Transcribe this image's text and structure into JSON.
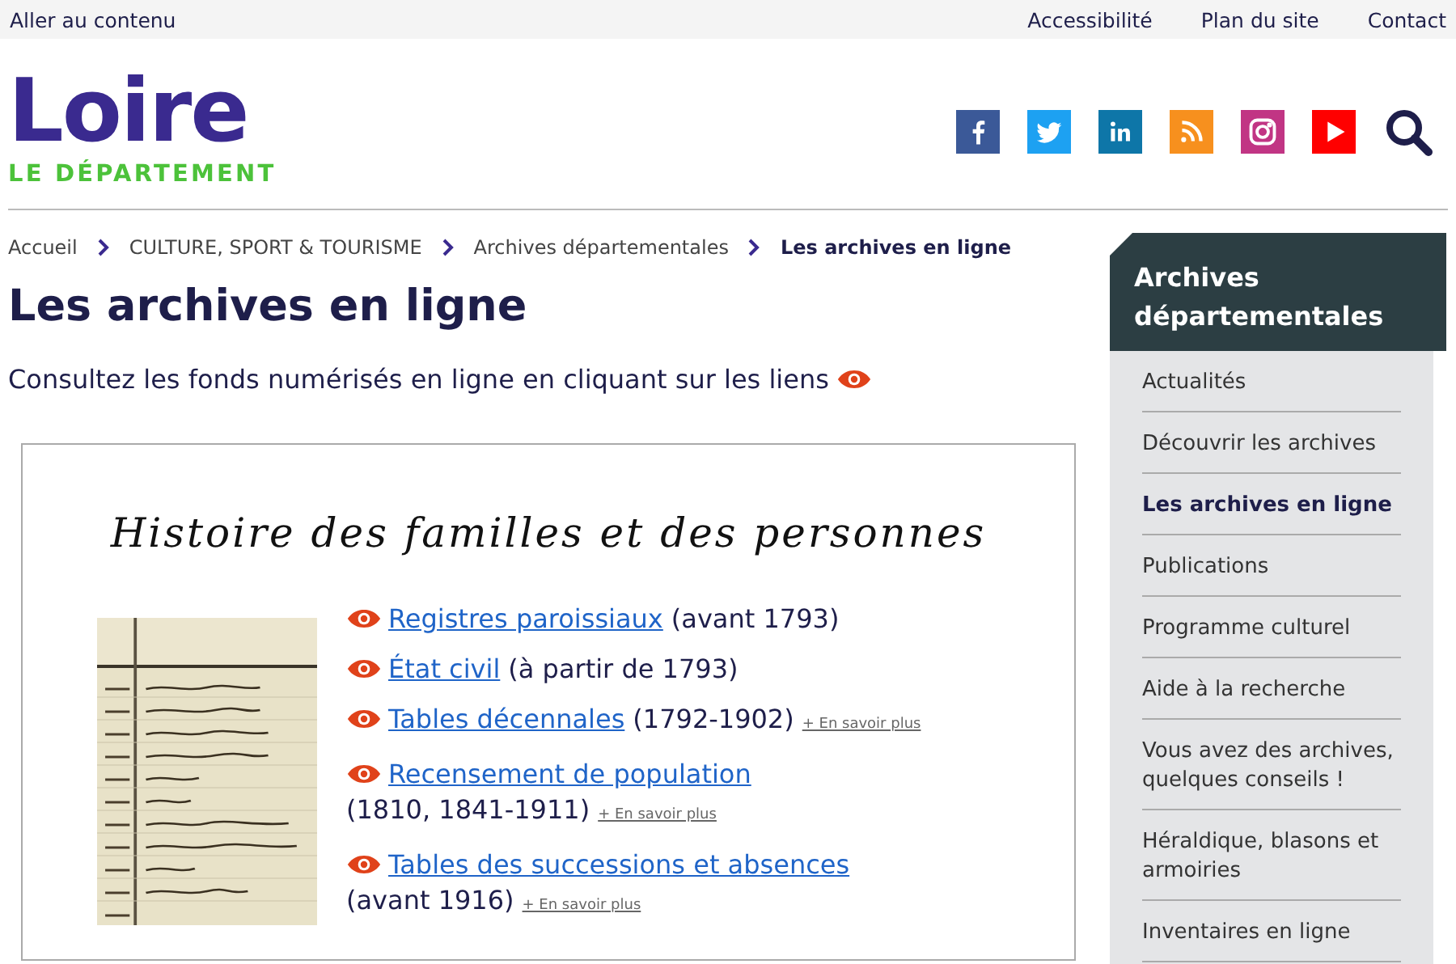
{
  "topbar": {
    "skip_link": "Aller au contenu",
    "links": [
      "Accessibilité",
      "Plan du site",
      "Contact"
    ]
  },
  "logo": {
    "name": "Loire",
    "subtitle": "LE DÉPARTEMENT"
  },
  "social": [
    {
      "kind": "facebook"
    },
    {
      "kind": "twitter"
    },
    {
      "kind": "linkedin"
    },
    {
      "kind": "rss"
    },
    {
      "kind": "instagram"
    },
    {
      "kind": "youtube"
    }
  ],
  "breadcrumb": [
    {
      "label": "Accueil",
      "current": false
    },
    {
      "label": "CULTURE, SPORT & TOURISME",
      "current": false
    },
    {
      "label": "Archives départementales",
      "current": false
    },
    {
      "label": "Les archives en ligne",
      "current": true
    }
  ],
  "title": "Les archives en ligne",
  "intro": "Consultez les fonds numérisés en ligne en cliquant sur les liens",
  "panel": {
    "heading": "Histoire des familles et des personnes",
    "links": [
      {
        "link": "Registres paroissiaux",
        "text": "(avant 1793)",
        "wrap": false
      },
      {
        "link": "État civil",
        "text": "(à partir de 1793)",
        "wrap": false
      },
      {
        "link": "Tables décennales",
        "text": "(1792-1902)",
        "more": "+ En savoir plus",
        "wrap": false
      },
      {
        "link": "Recensement de population",
        "text": "(1810, 1841-1911)",
        "more": "+ En savoir plus",
        "wrap": true
      },
      {
        "link": "Tables des successions et absences",
        "text": "(avant 1916)",
        "more": "+ En savoir plus",
        "wrap": true
      }
    ]
  },
  "sidebar": {
    "heading": "Archives départementales",
    "items": [
      {
        "label": "Actualités",
        "selected": false
      },
      {
        "label": "Découvrir les archives",
        "selected": false
      },
      {
        "label": "Les archives en ligne",
        "selected": true
      },
      {
        "label": "Publications",
        "selected": false
      },
      {
        "label": "Programme culturel",
        "selected": false
      },
      {
        "label": "Aide à la recherche",
        "selected": false
      },
      {
        "label": "Vous avez des archives, quelques conseils !",
        "selected": false
      },
      {
        "label": "Héraldique, blasons et armoiries",
        "selected": false
      },
      {
        "label": "Inventaires en ligne",
        "selected": false
      }
    ]
  }
}
